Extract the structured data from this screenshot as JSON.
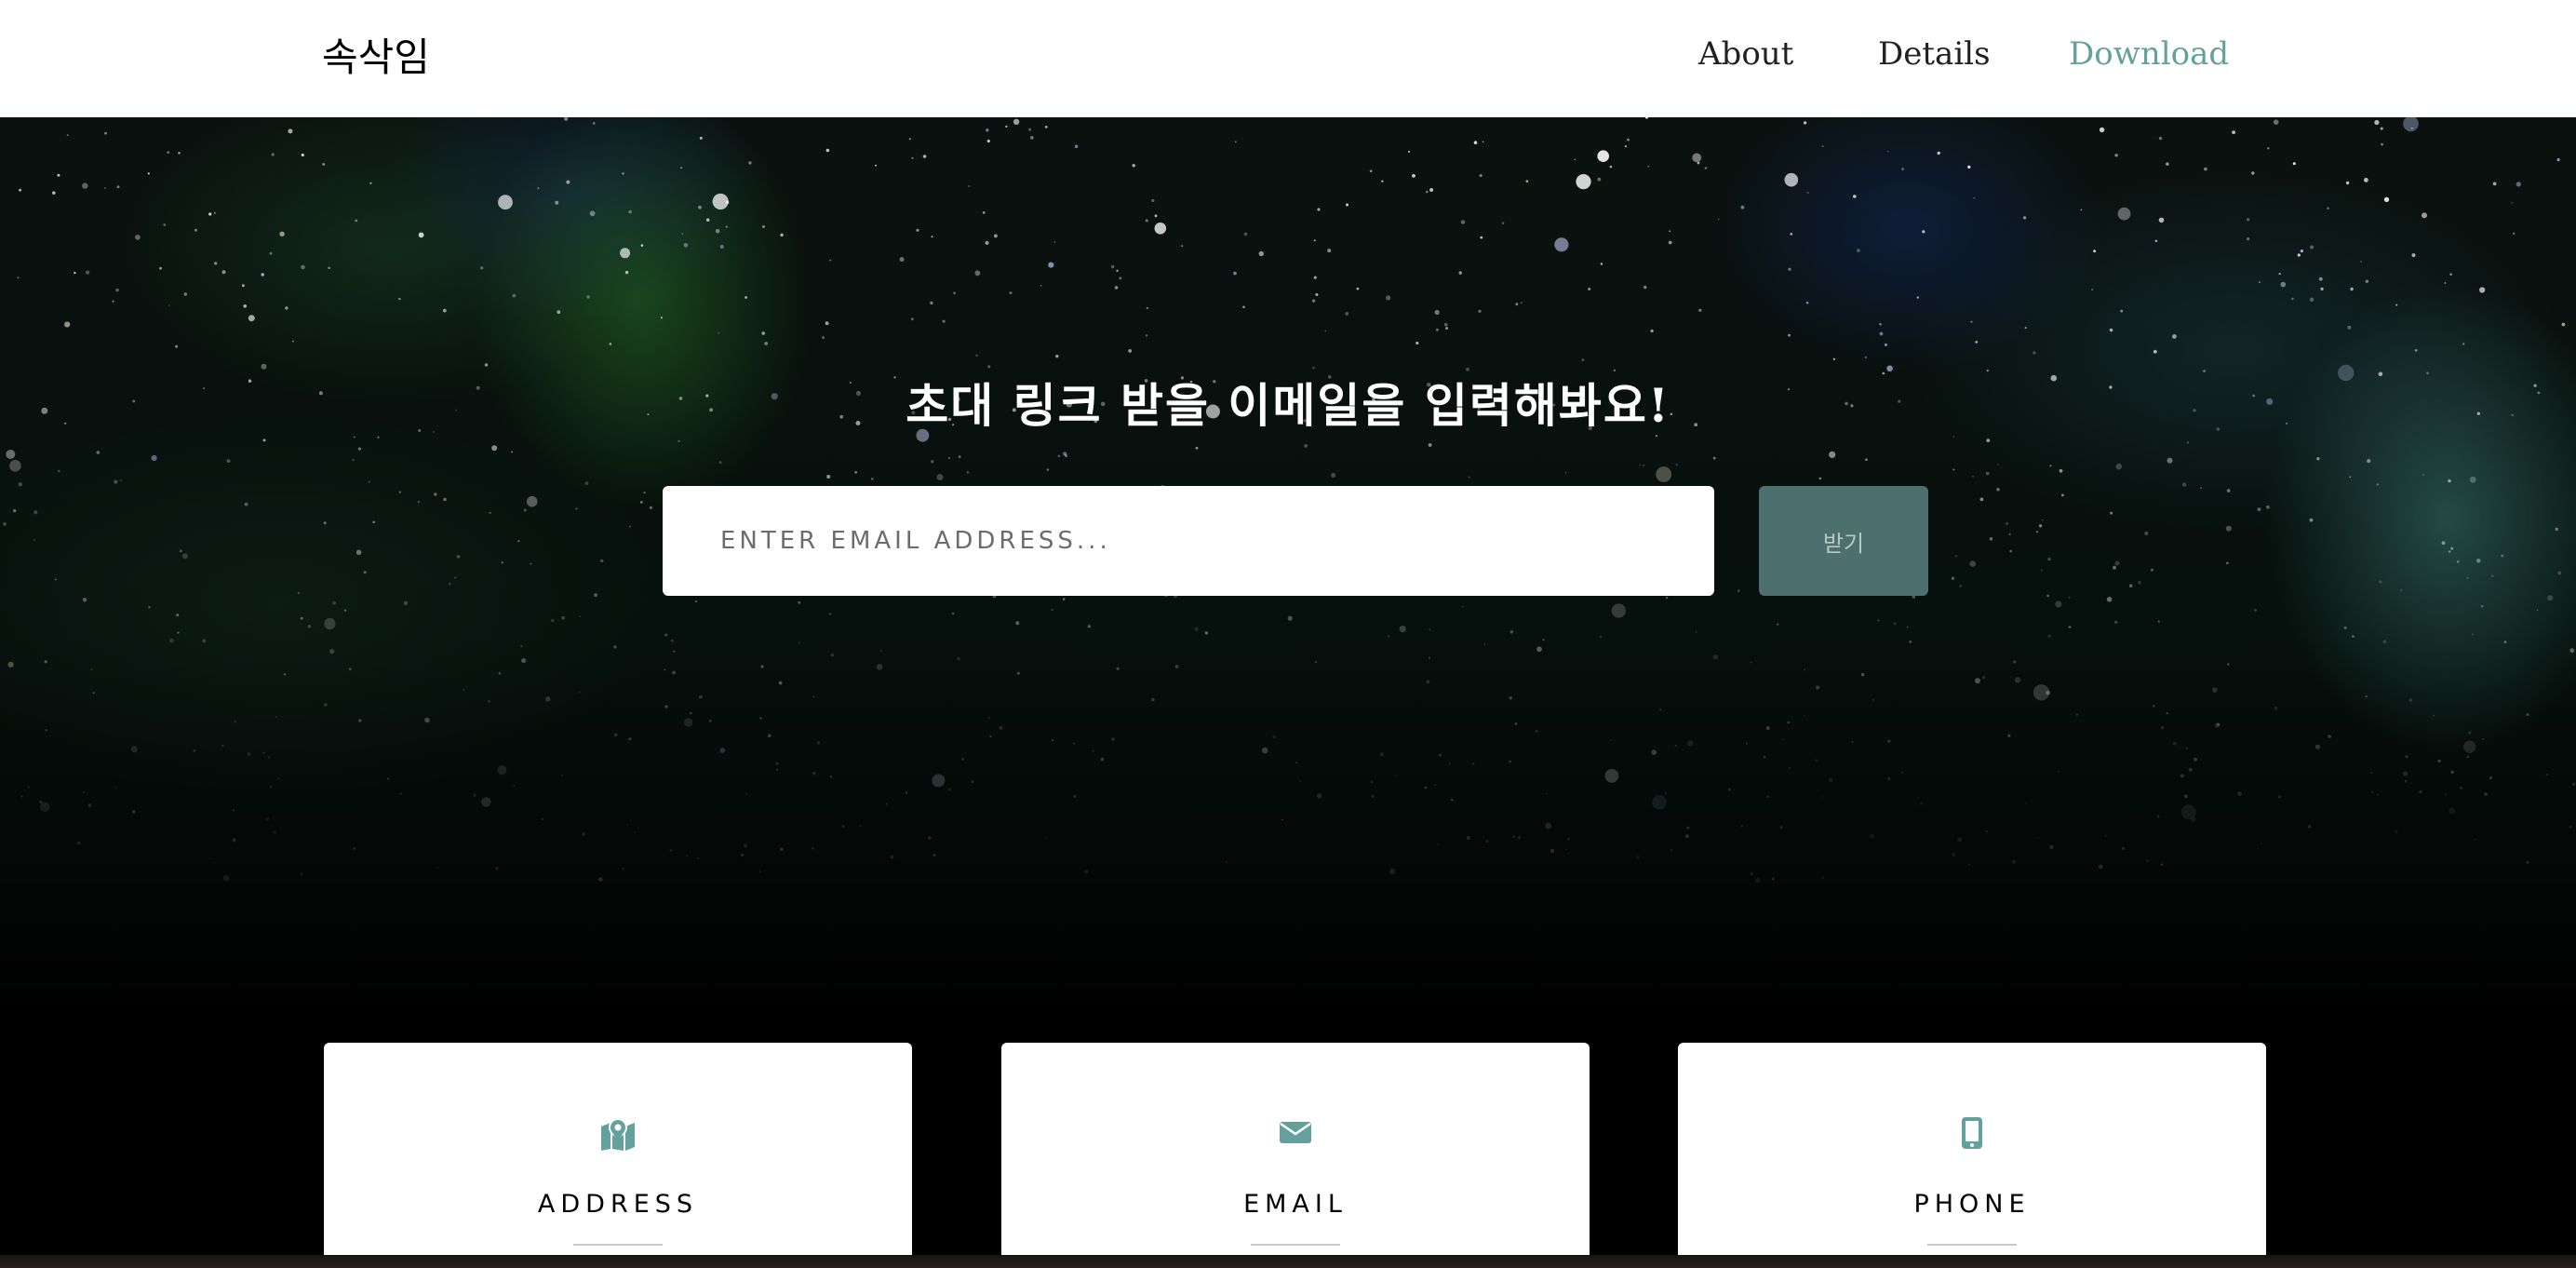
{
  "nav": {
    "brand": "속삭임",
    "links": [
      {
        "label": "About"
      },
      {
        "label": "Details"
      },
      {
        "label": "Download"
      }
    ]
  },
  "hero": {
    "title": "초대 링크 받을 이메일을 입력해봐요!",
    "email_placeholder": "ENTER EMAIL ADDRESS...",
    "email_value": "",
    "submit_label": "받기"
  },
  "cards": [
    {
      "icon": "map-marked-icon",
      "title": "ADDRESS"
    },
    {
      "icon": "envelope-icon",
      "title": "EMAIL"
    },
    {
      "icon": "mobile-phone-icon",
      "title": "PHONE"
    }
  ],
  "colors": {
    "accent": "#64a19d",
    "button_bg": "#4d6f6d",
    "nav_bg": "#ffffff",
    "page_bg": "#000000"
  }
}
